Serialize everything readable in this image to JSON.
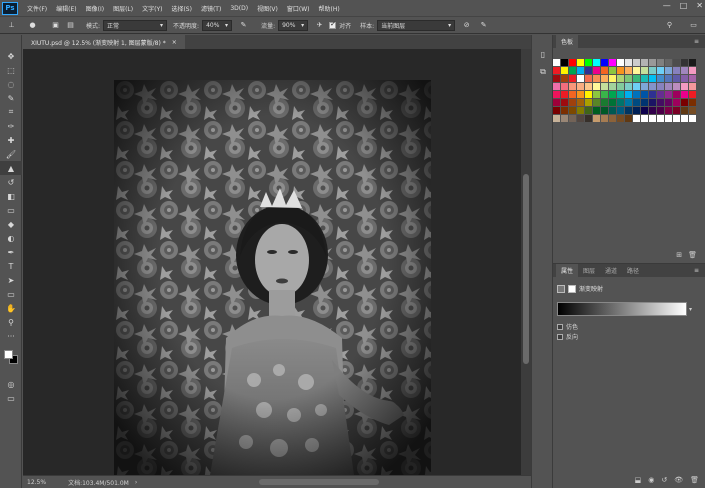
{
  "app": {
    "logo": "Ps"
  },
  "menu": [
    "文件(F)",
    "编辑(E)",
    "图像(I)",
    "图层(L)",
    "文字(Y)",
    "选择(S)",
    "滤镜(T)",
    "3D(D)",
    "视图(V)",
    "窗口(W)",
    "帮助(H)"
  ],
  "window_controls": [
    "—",
    "□",
    "✕"
  ],
  "options": {
    "mode_label": "模式:",
    "mode_value": "正常",
    "opacity_label": "不透明度:",
    "opacity_value": "40%",
    "flow_label": "流量:",
    "flow_value": "90%",
    "align_label": "对齐",
    "sample_label": "样本:",
    "sample_value": "当前图层"
  },
  "document": {
    "tab_title": "XIUTU.psd @ 12.5% (渐变映射 1, 图层蒙版/8) *",
    "tab_close": "×",
    "zoom": "12.5%",
    "doc_size": "文档:103.4M/501.0M",
    "arrow": "›"
  },
  "swatch_panel": {
    "tab": "色板",
    "menu_icon": "≡"
  },
  "properties_panel": {
    "tabs": [
      "属性",
      "图层",
      "通道",
      "路径"
    ],
    "title": "渐变映射",
    "checks": [
      "仿色",
      "反向"
    ]
  },
  "colors": {
    "foreground": "#ffffff",
    "background": "#000000",
    "swatch_rows": [
      [
        "#ffffff",
        "#000000",
        "#ff0000",
        "#ffff00",
        "#00ff00",
        "#00ffff",
        "#0000ff",
        "#ff00ff",
        "#ffffff",
        "#e6e6e6",
        "#cccccc",
        "#b3b3b3",
        "#999999",
        "#808080",
        "#666666",
        "#4d4d4d",
        "#333333",
        "#1a1a1a"
      ],
      [
        "#ed1c24",
        "#fff200",
        "#00a651",
        "#00aeef",
        "#2e3192",
        "#ec008c",
        "#f26522",
        "#8dc63f",
        "#f7941d",
        "#fbaf5d",
        "#fff799",
        "#c4df9b",
        "#7accc8",
        "#6dcff6",
        "#7da7d9",
        "#8781bd",
        "#a186be",
        "#f49ac1"
      ],
      [
        "#9e0b0f",
        "#a0410d",
        "#ed1c24",
        "#ffffff",
        "#f26c4f",
        "#f68e56",
        "#fbaf5d",
        "#fff568",
        "#acd373",
        "#7cc576",
        "#3bb878",
        "#1abbb4",
        "#00bff3",
        "#438ccb",
        "#5574b9",
        "#605ca8",
        "#855fa8",
        "#a763a8"
      ],
      [
        "#f06eaa",
        "#f26d7d",
        "#f7977a",
        "#f9ad81",
        "#fdc68a",
        "#fff79a",
        "#c4df9b",
        "#a3d39c",
        "#82ca9c",
        "#7bcdc8",
        "#6ecff6",
        "#7ea7d8",
        "#8493ca",
        "#8882be",
        "#a187be",
        "#bc8dbf",
        "#f49ac2",
        "#f6989d"
      ],
      [
        "#ed145b",
        "#ed1c24",
        "#f26522",
        "#f7941d",
        "#fff200",
        "#8dc63f",
        "#39b54a",
        "#00a651",
        "#00a99d",
        "#00aeef",
        "#0072bc",
        "#0054a6",
        "#2e3192",
        "#662d91",
        "#92278f",
        "#9e005d",
        "#ec008c",
        "#ed1c24"
      ],
      [
        "#9e0039",
        "#9e0b0f",
        "#a0410d",
        "#a36209",
        "#aba000",
        "#598527",
        "#1a7b30",
        "#007236",
        "#00746b",
        "#0076a3",
        "#004b80",
        "#003471",
        "#1b1464",
        "#440e62",
        "#630460",
        "#9e005d",
        "#790000",
        "#7b2e00"
      ],
      [
        "#790000",
        "#7b2e00",
        "#7d4900",
        "#827b00",
        "#406618",
        "#005e20",
        "#005826",
        "#005952",
        "#005b7f",
        "#003663",
        "#002157",
        "#0d004c",
        "#32004b",
        "#4b0049",
        "#7b0046",
        "#7a0026",
        "#603913",
        "#754c24"
      ],
      [
        "#c7b299",
        "#998675",
        "#736357",
        "#534741",
        "#37302a",
        "#c69c6d",
        "#a67c52",
        "#8c6239",
        "#754c24",
        "#603913",
        "#ffffff",
        "#ffffff",
        "#ffffff",
        "#ffffff",
        "#ffffff",
        "#ffffff",
        "#ffffff",
        "#ffffff"
      ]
    ]
  },
  "icons": {
    "tools": [
      "move-icon",
      "marquee-icon",
      "lasso-icon",
      "quick-select-icon",
      "crop-icon",
      "eyedropper-icon",
      "healing-icon",
      "brush-icon",
      "clone-stamp-icon",
      "history-brush-icon",
      "eraser-icon",
      "gradient-icon",
      "blur-icon",
      "dodge-icon",
      "pen-icon",
      "type-icon",
      "path-select-icon",
      "shape-icon",
      "hand-icon",
      "zoom-icon",
      "more-icon"
    ],
    "tool_glyphs": [
      "✥",
      "⬚",
      "◌",
      "✎",
      "⌗",
      "✑",
      "✚",
      "🖌",
      "▲",
      "↺",
      "◧",
      "▭",
      "◆",
      "◐",
      "✒",
      "T",
      "➤",
      "▭",
      "✋",
      "⚲",
      "···"
    ]
  }
}
